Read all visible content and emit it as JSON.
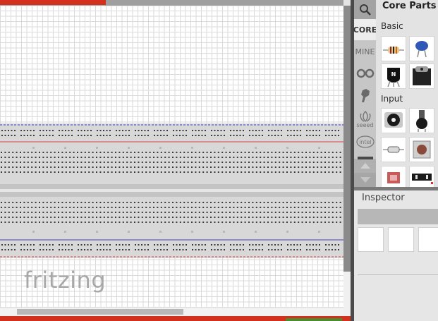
{
  "canvas": {
    "logo_text": "fritzing"
  },
  "parts_bin": {
    "title": "Core Parts",
    "tabs": {
      "search_icon": "search-icon",
      "core": "CORE",
      "mine": "MINE",
      "seeed": "seeed",
      "intel": "intel"
    },
    "sections": {
      "basic": "Basic",
      "input": "Input"
    },
    "parts": {
      "basic": [
        "resistor",
        "ceramic-capacitor",
        "npn-transistor",
        "mosfet"
      ],
      "input": [
        "potentiometer",
        "rotary-potentiometer",
        "reed-switch",
        "pushbutton",
        "sensor",
        "dip-switch"
      ]
    }
  },
  "inspector": {
    "title": "Inspector"
  },
  "colors": {
    "accent_red": "#d3301d",
    "breadboard": "#d8d8d8",
    "rail_red": "#d94040",
    "rail_blue": "#4040c0"
  }
}
